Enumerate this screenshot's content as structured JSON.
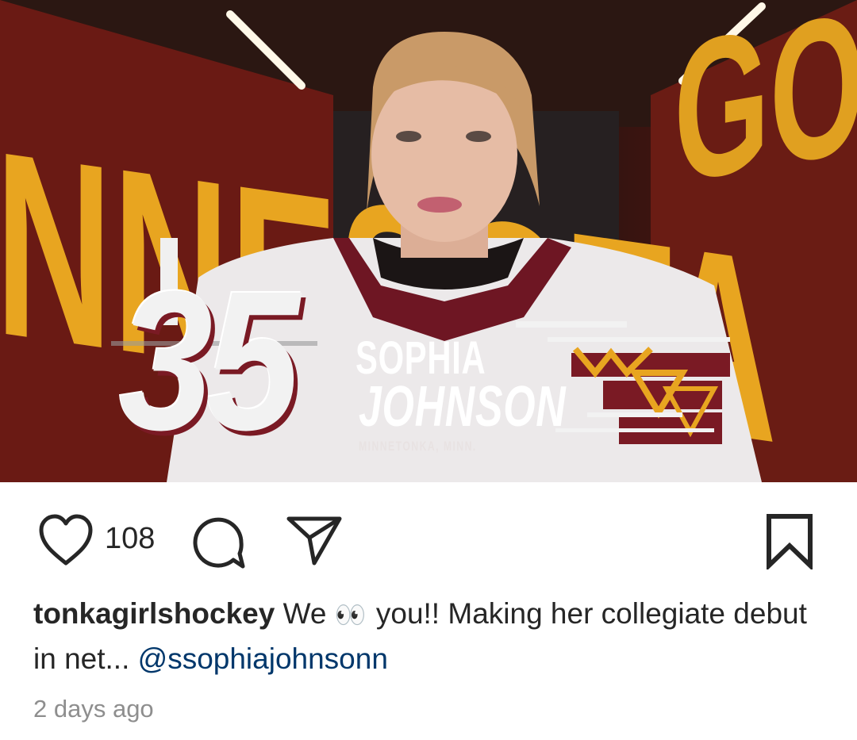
{
  "media": {
    "jersey_number": "35",
    "first_name": "SOPHIA",
    "last_name": "JOHNSON",
    "hometown": "MINNETONKA, MINN.",
    "left_wall_text": "NNESOTA",
    "right_wall_text": "GOPH",
    "colors": {
      "maroon": "#7a1a24",
      "gold": "#e8a520"
    }
  },
  "actions": {
    "like_icon": "heart-icon",
    "like_count": "108",
    "comment_icon": "comment-icon",
    "share_icon": "paper-plane-icon",
    "save_icon": "bookmark-icon"
  },
  "caption": {
    "username": "tonkagirlshockey",
    "text_before_emoji": "We",
    "emoji": "👀",
    "text_after_emoji": "you!! Making her collegiate debut in net...",
    "mention": "@ssophiajohnsonn"
  },
  "timestamp": "2 days ago"
}
